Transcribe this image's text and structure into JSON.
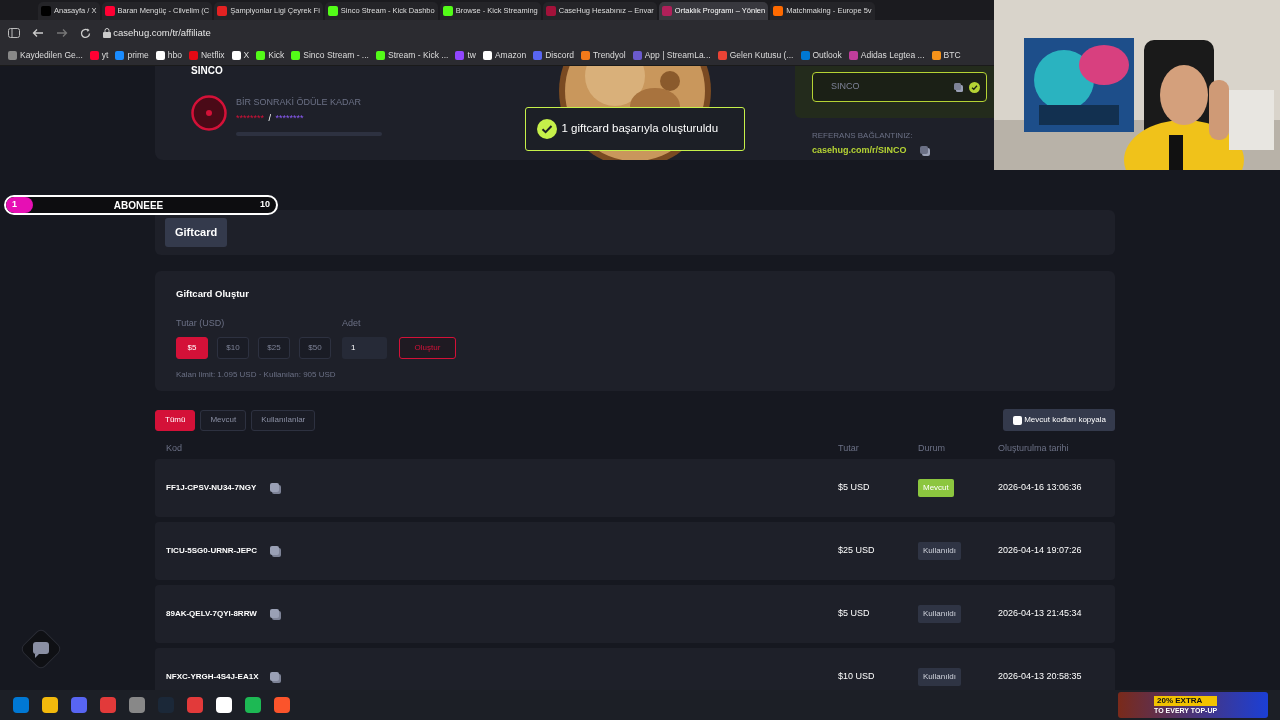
{
  "browser": {
    "tabs": [
      {
        "title": "Anasayfa / X",
        "selected": false
      },
      {
        "title": "Baran Mengüç - Cilvelim (C",
        "selected": false
      },
      {
        "title": "Şampiyonlar Ligi Çeyrek Fi",
        "selected": false
      },
      {
        "title": "Sinco Stream - Kick Dashbo",
        "selected": false
      },
      {
        "title": "Browse - Kick Streaming",
        "selected": false
      },
      {
        "title": "CaseHug Hesabınız – Envar",
        "selected": false
      },
      {
        "title": "Ortaklık Programı – Yönlen",
        "selected": true
      },
      {
        "title": "Matchmaking - Europe 5v",
        "selected": false
      }
    ],
    "address": "casehug.com/tr/affiliate",
    "bookmarks": [
      {
        "label": "Kaydedilen Ge..."
      },
      {
        "label": "yt"
      },
      {
        "label": "prime"
      },
      {
        "label": "hbo"
      },
      {
        "label": "Netflix"
      },
      {
        "label": "X"
      },
      {
        "label": "Kick"
      },
      {
        "label": "Sinco Stream - ..."
      },
      {
        "label": "Stream - Kick ..."
      },
      {
        "label": "tw"
      },
      {
        "label": "Amazon"
      },
      {
        "label": "Discord"
      },
      {
        "label": "Trendyol"
      },
      {
        "label": "App | StreamLa..."
      },
      {
        "label": "Gelen Kutusu (..."
      },
      {
        "label": "Outlook"
      },
      {
        "label": "Adidas Legtea ..."
      },
      {
        "label": "BTC"
      }
    ]
  },
  "profile": {
    "name": "SINCO",
    "next_reward_label": "BİR SONRAKİ ÖDÜLE KADAR",
    "progress_from": "********",
    "separator": "/",
    "progress_to": "********"
  },
  "referral": {
    "code": "SINCO",
    "link_label": "REFERANS BAĞLANTINIZ:",
    "link": "casehug.com/r/SINCO"
  },
  "toast": {
    "message": "1 giftcard başarıyla oluşturuldu"
  },
  "sub_goal": {
    "current": "1",
    "title": "ABONEEE",
    "target": "10",
    "level": 0.1
  },
  "section_tabs": [
    {
      "label": "Giftcard",
      "selected": true
    }
  ],
  "create": {
    "title": "Giftcard Oluştur",
    "amount_label": "Tutar (USD)",
    "amounts": [
      {
        "label": "$5",
        "selected": true
      },
      {
        "label": "$10",
        "selected": false
      },
      {
        "label": "$25",
        "selected": false
      },
      {
        "label": "$50",
        "selected": false
      }
    ],
    "count_label": "Adet",
    "count": "1",
    "submit": "Oluştur",
    "limit_text": "Kalan limit: 1.095 USD · Kullanılan: 905 USD"
  },
  "filters": [
    {
      "label": "Tümü",
      "selected": true
    },
    {
      "label": "Mevcut",
      "selected": false
    },
    {
      "label": "Kullanılanlar",
      "selected": false
    }
  ],
  "copy_button": "Mevcut kodları kopyala",
  "table": {
    "columns": [
      "Kod",
      "Tutar",
      "Durum",
      "Oluşturulma tarihi"
    ],
    "rows": [
      {
        "code": "FF1J-CPSV-NU34-7NGY",
        "amount": "$5 USD",
        "status": "Mevcut",
        "kind": "available",
        "date": "2026-04-16 13:06:36"
      },
      {
        "code": "TICU-5SG0-URNR-JEPC",
        "amount": "$25 USD",
        "status": "Kullanıldı",
        "kind": "used",
        "date": "2026-04-14 19:07:26"
      },
      {
        "code": "89AK-QELV-7QYI-8RRW",
        "amount": "$5 USD",
        "status": "Kullanıldı",
        "kind": "used",
        "date": "2026-04-13 21:45:34"
      },
      {
        "code": "NFXC-YRGH-4S4J-EA1X",
        "amount": "$10 USD",
        "status": "Kullanıldı",
        "kind": "used",
        "date": "2026-04-13 20:58:35"
      }
    ]
  },
  "promo": {
    "title": "20% EXTRA",
    "subtitle": "TO EVERY TOP-UP"
  }
}
